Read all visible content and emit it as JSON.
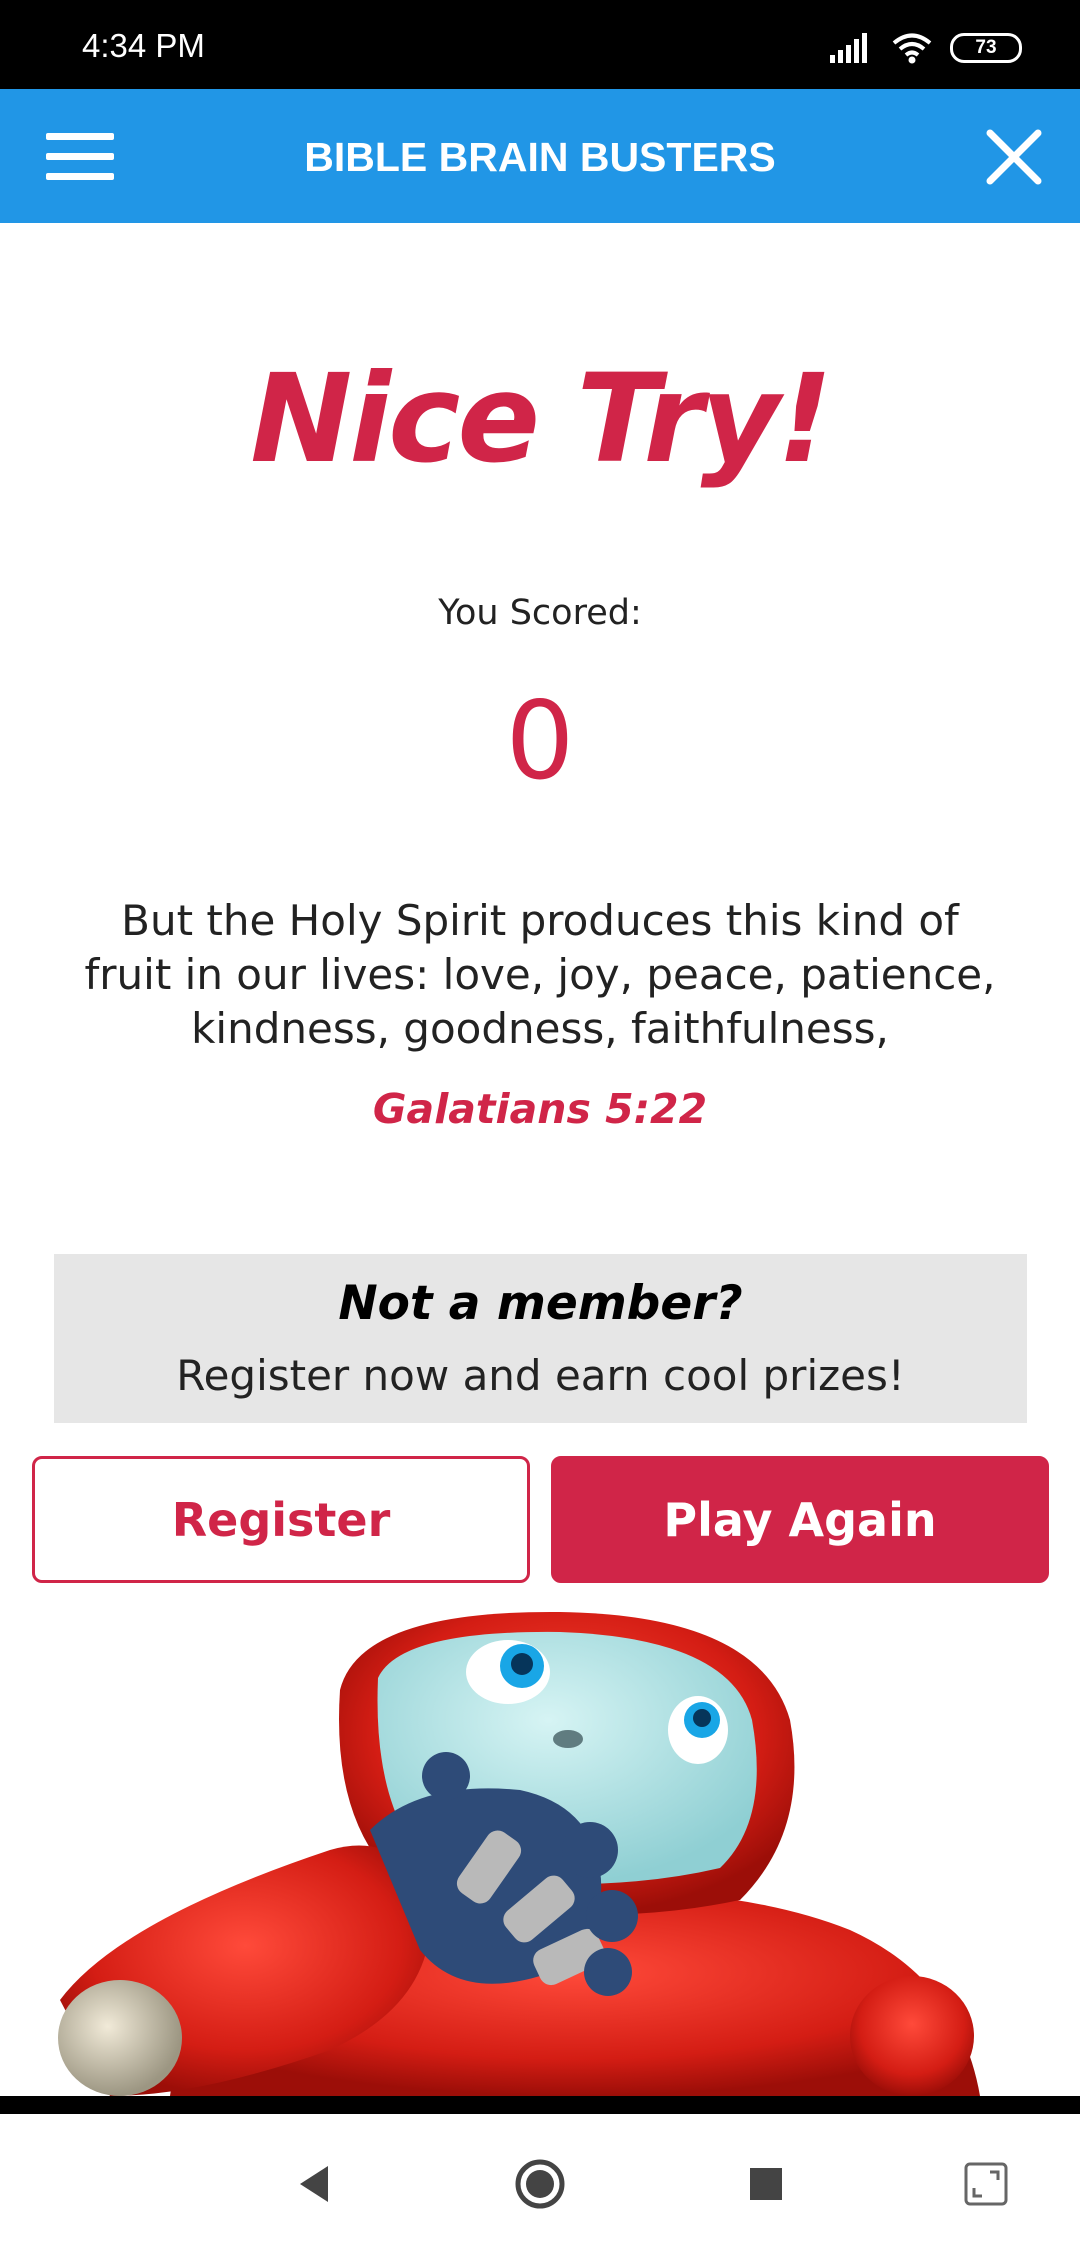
{
  "status_bar": {
    "time": "4:34 PM",
    "battery": "73",
    "icons": [
      "signal-icon",
      "wifi-icon",
      "battery-icon"
    ]
  },
  "header": {
    "title": "BIBLE BRAIN BUSTERS",
    "menu_icon": "hamburger-menu-icon",
    "close_icon": "close-icon",
    "background_color": "#2196e6"
  },
  "result": {
    "headline": "Nice Try!",
    "score_label": "You Scored:",
    "score": "0",
    "accent_color": "#d02548"
  },
  "verse": {
    "text": "But the Holy Spirit produces this kind of fruit in our lives: love, joy, peace, patience, kindness, goodness, faithfulness,",
    "reference": "Galatians 5:22"
  },
  "member_prompt": {
    "title": "Not a member?",
    "subtitle": "Register now and earn cool prizes!"
  },
  "buttons": {
    "register_label": "Register",
    "play_again_label": "Play Again"
  },
  "nav_bar": {
    "icons": [
      "back-icon",
      "home-icon",
      "recents-icon",
      "screen-expand-icon"
    ]
  }
}
